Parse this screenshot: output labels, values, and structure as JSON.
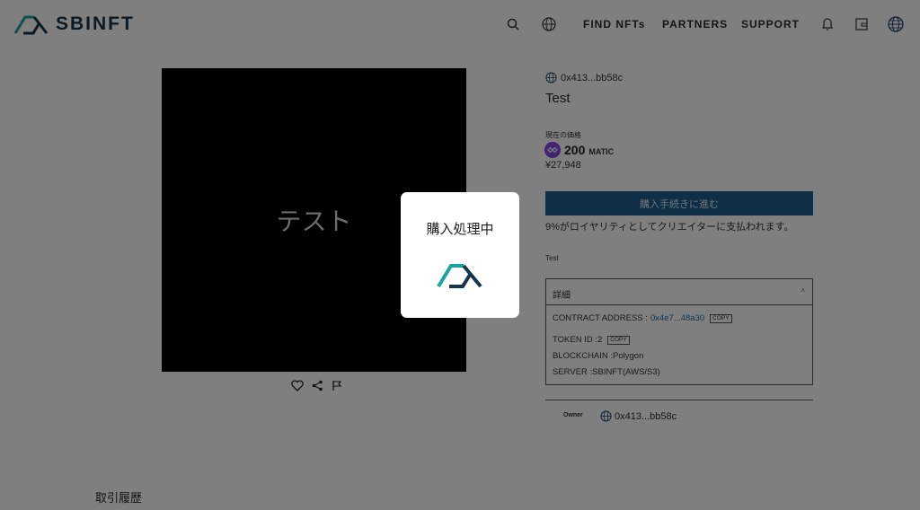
{
  "header": {
    "brand": "SBINFT",
    "nav": [
      {
        "label": "FIND NFTs"
      },
      {
        "label": "PARTNERS"
      },
      {
        "label": "SUPPORT"
      }
    ],
    "icons": [
      "search-icon",
      "language-icon",
      "bell-icon",
      "wallet-icon",
      "account-icon"
    ]
  },
  "nft": {
    "image_text": "テスト",
    "creator_address": "0x413...bb58c",
    "title": "Test",
    "price_label": "現在の価格",
    "price_value": "200",
    "price_unit": "MATIC",
    "price_jpy": "¥27,948",
    "buy_button": "購入手続きに進む",
    "royalty_note": "9%がロイヤリティとしてクリエイターに支払われます。",
    "description": "Test"
  },
  "details": {
    "heading": "詳細",
    "toggle": "˄",
    "contract_label": "CONTRACT ADDRESS :",
    "contract_value": "0x4e7...48a30",
    "token_label": "TOKEN ID :2",
    "blockchain": "BLOCKCHAIN :Polygon",
    "server": "SERVER :SBINFT(AWS/S3)",
    "copy": "COPY"
  },
  "owner": {
    "label": "Owner",
    "address": "0x413...bb58c"
  },
  "history_title": "取引履歴",
  "modal": {
    "title": "購入処理中"
  },
  "colors": {
    "brand": "#16354a",
    "accent_teal": "#1aa3a0",
    "buy_button": "#1e5f8c",
    "matic": "#8247e5",
    "link": "#1f6fa8"
  }
}
